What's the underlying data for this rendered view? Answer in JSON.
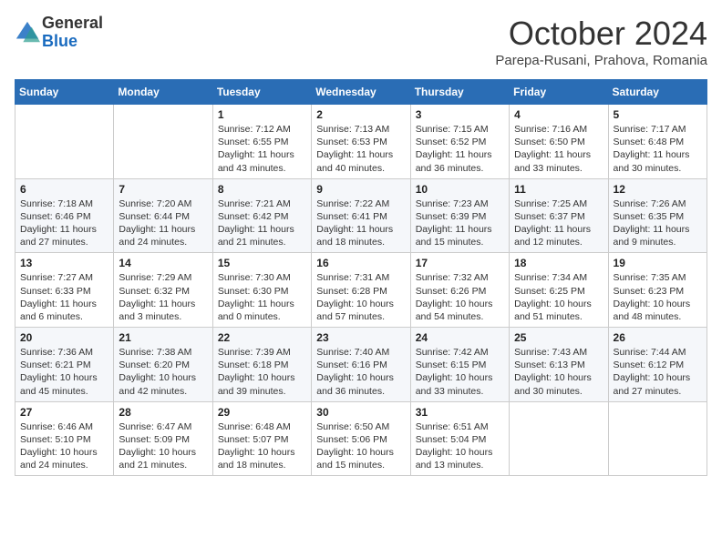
{
  "header": {
    "logo_general": "General",
    "logo_blue": "Blue",
    "month_title": "October 2024",
    "subtitle": "Parepa-Rusani, Prahova, Romania"
  },
  "days_of_week": [
    "Sunday",
    "Monday",
    "Tuesday",
    "Wednesday",
    "Thursday",
    "Friday",
    "Saturday"
  ],
  "weeks": [
    [
      {
        "day": "",
        "info": ""
      },
      {
        "day": "",
        "info": ""
      },
      {
        "day": "1",
        "info": "Sunrise: 7:12 AM\nSunset: 6:55 PM\nDaylight: 11 hours and 43 minutes."
      },
      {
        "day": "2",
        "info": "Sunrise: 7:13 AM\nSunset: 6:53 PM\nDaylight: 11 hours and 40 minutes."
      },
      {
        "day": "3",
        "info": "Sunrise: 7:15 AM\nSunset: 6:52 PM\nDaylight: 11 hours and 36 minutes."
      },
      {
        "day": "4",
        "info": "Sunrise: 7:16 AM\nSunset: 6:50 PM\nDaylight: 11 hours and 33 minutes."
      },
      {
        "day": "5",
        "info": "Sunrise: 7:17 AM\nSunset: 6:48 PM\nDaylight: 11 hours and 30 minutes."
      }
    ],
    [
      {
        "day": "6",
        "info": "Sunrise: 7:18 AM\nSunset: 6:46 PM\nDaylight: 11 hours and 27 minutes."
      },
      {
        "day": "7",
        "info": "Sunrise: 7:20 AM\nSunset: 6:44 PM\nDaylight: 11 hours and 24 minutes."
      },
      {
        "day": "8",
        "info": "Sunrise: 7:21 AM\nSunset: 6:42 PM\nDaylight: 11 hours and 21 minutes."
      },
      {
        "day": "9",
        "info": "Sunrise: 7:22 AM\nSunset: 6:41 PM\nDaylight: 11 hours and 18 minutes."
      },
      {
        "day": "10",
        "info": "Sunrise: 7:23 AM\nSunset: 6:39 PM\nDaylight: 11 hours and 15 minutes."
      },
      {
        "day": "11",
        "info": "Sunrise: 7:25 AM\nSunset: 6:37 PM\nDaylight: 11 hours and 12 minutes."
      },
      {
        "day": "12",
        "info": "Sunrise: 7:26 AM\nSunset: 6:35 PM\nDaylight: 11 hours and 9 minutes."
      }
    ],
    [
      {
        "day": "13",
        "info": "Sunrise: 7:27 AM\nSunset: 6:33 PM\nDaylight: 11 hours and 6 minutes."
      },
      {
        "day": "14",
        "info": "Sunrise: 7:29 AM\nSunset: 6:32 PM\nDaylight: 11 hours and 3 minutes."
      },
      {
        "day": "15",
        "info": "Sunrise: 7:30 AM\nSunset: 6:30 PM\nDaylight: 11 hours and 0 minutes."
      },
      {
        "day": "16",
        "info": "Sunrise: 7:31 AM\nSunset: 6:28 PM\nDaylight: 10 hours and 57 minutes."
      },
      {
        "day": "17",
        "info": "Sunrise: 7:32 AM\nSunset: 6:26 PM\nDaylight: 10 hours and 54 minutes."
      },
      {
        "day": "18",
        "info": "Sunrise: 7:34 AM\nSunset: 6:25 PM\nDaylight: 10 hours and 51 minutes."
      },
      {
        "day": "19",
        "info": "Sunrise: 7:35 AM\nSunset: 6:23 PM\nDaylight: 10 hours and 48 minutes."
      }
    ],
    [
      {
        "day": "20",
        "info": "Sunrise: 7:36 AM\nSunset: 6:21 PM\nDaylight: 10 hours and 45 minutes."
      },
      {
        "day": "21",
        "info": "Sunrise: 7:38 AM\nSunset: 6:20 PM\nDaylight: 10 hours and 42 minutes."
      },
      {
        "day": "22",
        "info": "Sunrise: 7:39 AM\nSunset: 6:18 PM\nDaylight: 10 hours and 39 minutes."
      },
      {
        "day": "23",
        "info": "Sunrise: 7:40 AM\nSunset: 6:16 PM\nDaylight: 10 hours and 36 minutes."
      },
      {
        "day": "24",
        "info": "Sunrise: 7:42 AM\nSunset: 6:15 PM\nDaylight: 10 hours and 33 minutes."
      },
      {
        "day": "25",
        "info": "Sunrise: 7:43 AM\nSunset: 6:13 PM\nDaylight: 10 hours and 30 minutes."
      },
      {
        "day": "26",
        "info": "Sunrise: 7:44 AM\nSunset: 6:12 PM\nDaylight: 10 hours and 27 minutes."
      }
    ],
    [
      {
        "day": "27",
        "info": "Sunrise: 6:46 AM\nSunset: 5:10 PM\nDaylight: 10 hours and 24 minutes."
      },
      {
        "day": "28",
        "info": "Sunrise: 6:47 AM\nSunset: 5:09 PM\nDaylight: 10 hours and 21 minutes."
      },
      {
        "day": "29",
        "info": "Sunrise: 6:48 AM\nSunset: 5:07 PM\nDaylight: 10 hours and 18 minutes."
      },
      {
        "day": "30",
        "info": "Sunrise: 6:50 AM\nSunset: 5:06 PM\nDaylight: 10 hours and 15 minutes."
      },
      {
        "day": "31",
        "info": "Sunrise: 6:51 AM\nSunset: 5:04 PM\nDaylight: 10 hours and 13 minutes."
      },
      {
        "day": "",
        "info": ""
      },
      {
        "day": "",
        "info": ""
      }
    ]
  ]
}
